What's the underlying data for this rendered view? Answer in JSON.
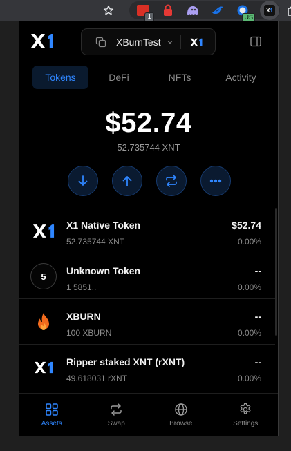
{
  "colors": {
    "accent": "#2f86ff",
    "background": "#000000",
    "muted": "#8a8a8a",
    "text": "#f2f2f2",
    "flame": "#f26b1d"
  },
  "browser": {
    "toolbar_icons": [
      "star-icon",
      "extension-badge-icon",
      "lock-extension-icon",
      "ghost-extension-icon",
      "bird-extension-icon",
      "globe-extension-icon",
      "x1-wallet-extension-icon",
      "puzzle-icon"
    ],
    "extension_badge_count": "1",
    "extension_badge_region": "US"
  },
  "header": {
    "logo": "X1",
    "account_name": "XBurnTest",
    "network_logo": "X1"
  },
  "tabs": [
    {
      "label": "Tokens",
      "active": true
    },
    {
      "label": "DeFi",
      "active": false
    },
    {
      "label": "NFTs",
      "active": false
    },
    {
      "label": "Activity",
      "active": false
    }
  ],
  "balance": {
    "usd": "$52.74",
    "native": "52.735744 XNT"
  },
  "actions": [
    "receive-arrow-icon",
    "send-arrow-icon",
    "swap-icon",
    "more-icon"
  ],
  "tokens": [
    {
      "name": "X1 Native Token",
      "amount": "52.735744 XNT",
      "value": "$52.74",
      "change": "0.00%",
      "icon": "x1-logo-icon"
    },
    {
      "name": "Unknown Token",
      "amount": "1 5851..",
      "value": "--",
      "change": "0.00%",
      "icon": "5"
    },
    {
      "name": "XBURN",
      "amount": "100 XBURN",
      "value": "--",
      "change": "0.00%",
      "icon": "flame-icon"
    },
    {
      "name": "Ripper staked XNT (rXNT)",
      "amount": "49.618031 rXNT",
      "value": "--",
      "change": "0.00%",
      "icon": "x1-logo-icon"
    }
  ],
  "nav": [
    {
      "label": "Assets",
      "icon": "grid-icon",
      "active": true
    },
    {
      "label": "Swap",
      "icon": "swap-icon",
      "active": false
    },
    {
      "label": "Browse",
      "icon": "globe-icon",
      "active": false
    },
    {
      "label": "Settings",
      "icon": "gear-icon",
      "active": false
    }
  ]
}
